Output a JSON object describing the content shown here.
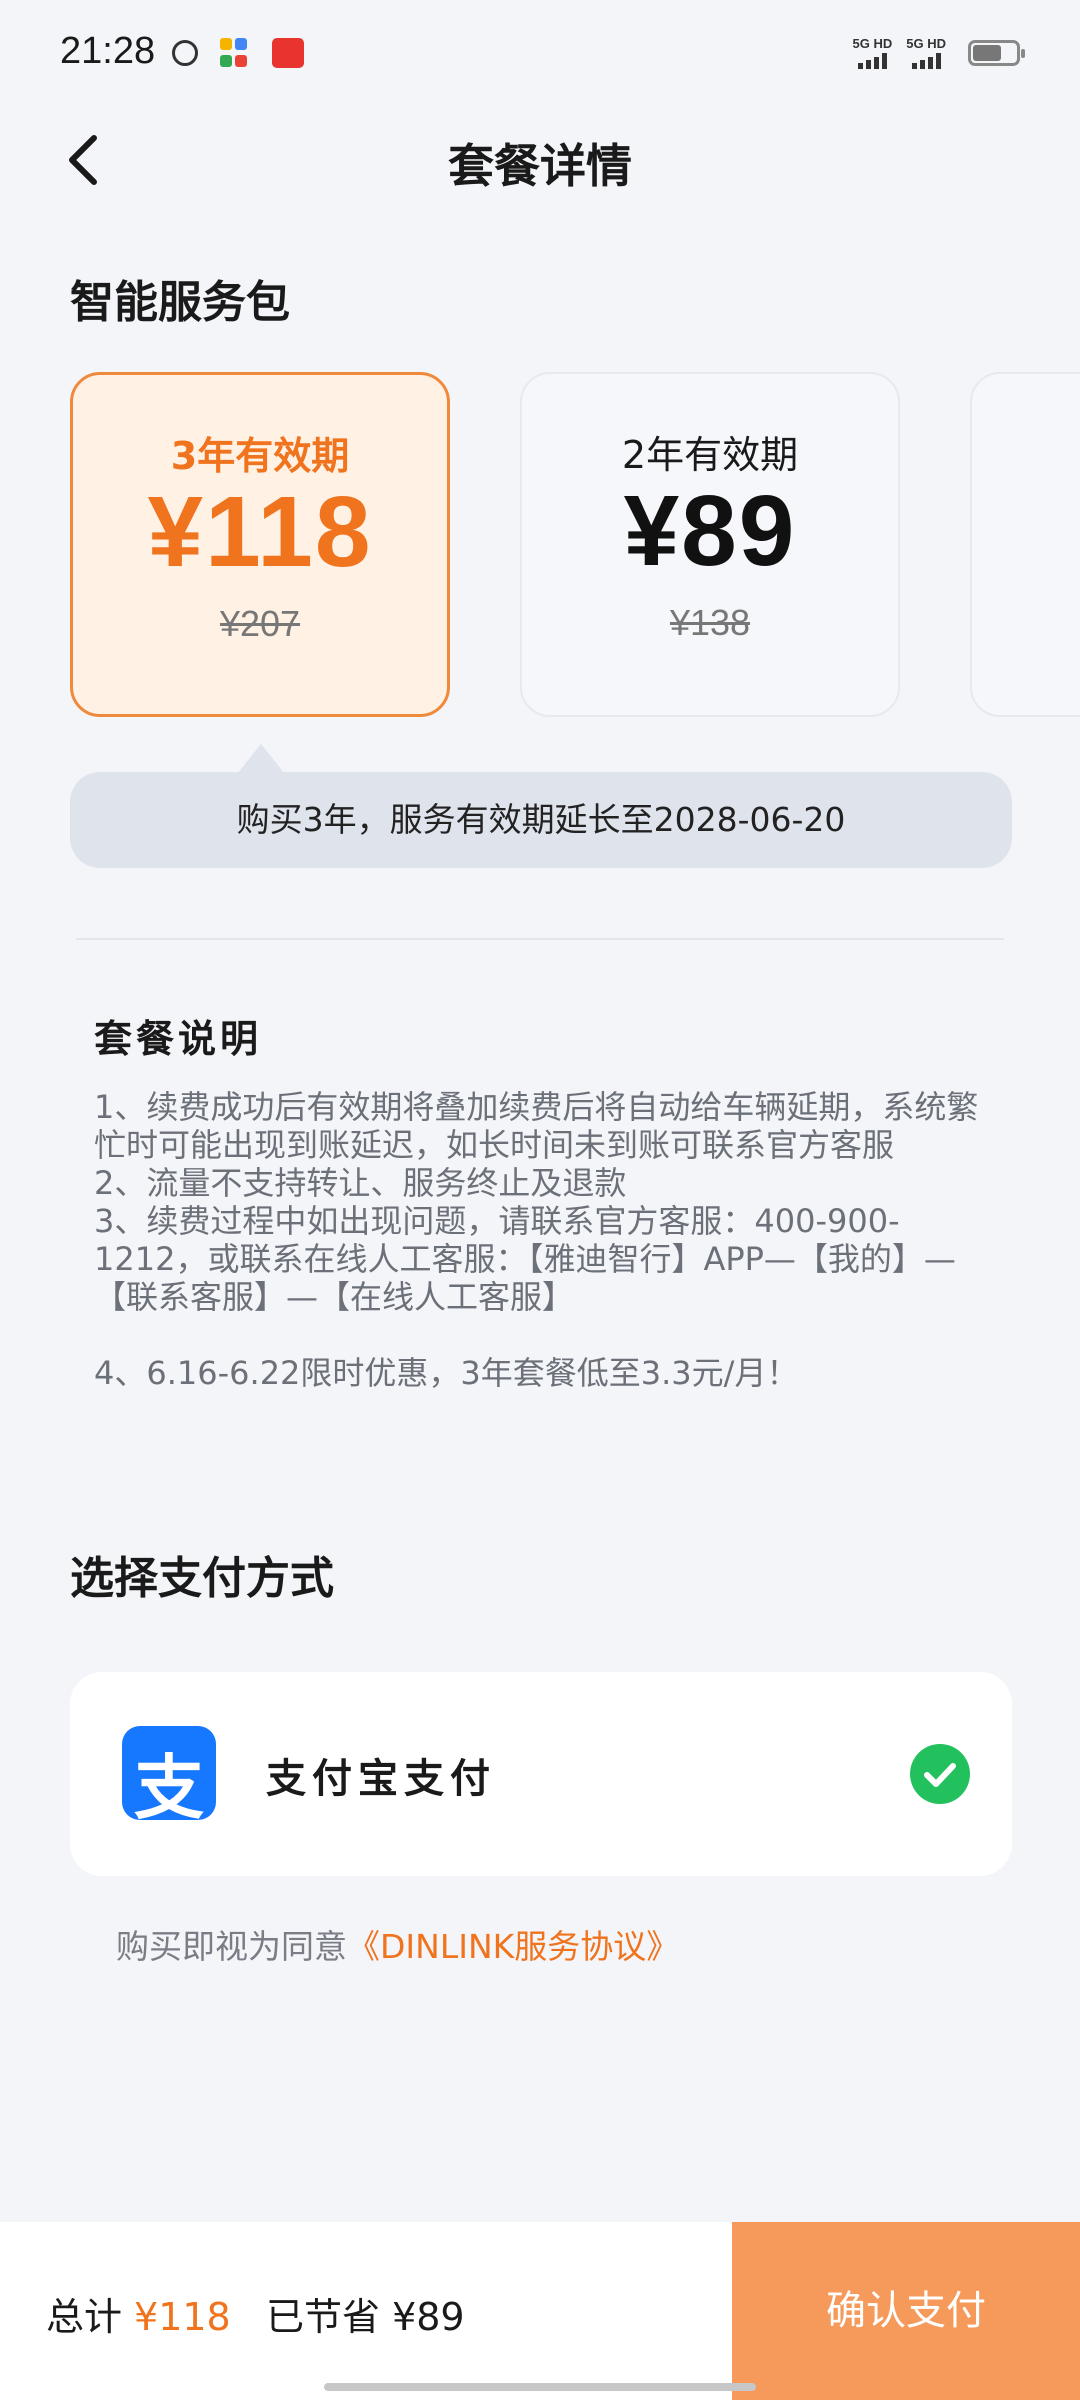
{
  "status_bar": {
    "time": "21:28",
    "signal1_label": "5G HD",
    "signal2_label": "5G HD",
    "icons": [
      "cloud-icon",
      "app-grid-icon",
      "app-badge-icon",
      "battery-icon"
    ]
  },
  "nav": {
    "title": "套餐详情",
    "back_icon": "chevron-left-icon"
  },
  "package": {
    "section_title": "智能服务包",
    "plans": [
      {
        "period": "3年有效期",
        "price": "¥118",
        "original_price": "¥207",
        "selected": true
      },
      {
        "period": "2年有效期",
        "price": "¥89",
        "original_price": "¥138",
        "selected": false
      }
    ],
    "tip": "购买3年，服务有效期延长至2028-06-20"
  },
  "description": {
    "title": "套餐说明",
    "lines": [
      "1、续费成功后有效期将叠加续费后将自动给车辆延期，系统繁忙时可能出现到账延迟，如长时间未到账可联系官方客服",
      "2、流量不支持转让、服务终止及退款",
      "3、续费过程中如出现问题，请联系官方客服：400-900-1212，或联系在线人工客服：【雅迪智行】APP—【我的】—【联系客服】—【在线人工客服】",
      "4、6.16-6.22限时优惠，3年套餐低至3.3元/月！"
    ]
  },
  "payment": {
    "section_title": "选择支付方式",
    "method_label": "支付宝支付",
    "logo_glyph": "支",
    "selected": true,
    "agreement_prefix": "购买即视为同意",
    "agreement_link": "《DINLINK服务协议》"
  },
  "footer": {
    "total_label": "总计",
    "total_amount": "¥118",
    "saved_text": "已节省 ¥89",
    "confirm_label": "确认支付"
  },
  "colors": {
    "accent": "#f0731e",
    "accent_button": "#f59a5a",
    "selected_card_bg": "#fff1e4",
    "alipay_blue": "#1677ff",
    "check_green": "#22c15e",
    "page_bg": "#f3f5f9"
  }
}
